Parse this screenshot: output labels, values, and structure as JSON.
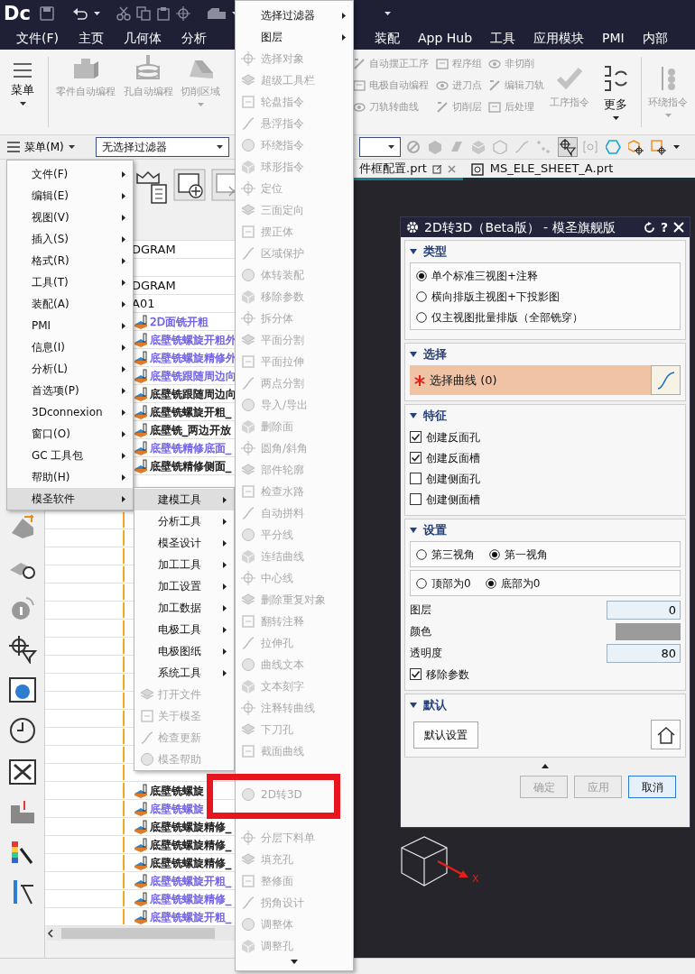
{
  "quick_access": {
    "logo": "Dc"
  },
  "menu_bar": {
    "left": [
      {
        "label": "文件(F)"
      },
      {
        "label": "主页"
      },
      {
        "label": "几何体"
      },
      {
        "label": "分析"
      }
    ],
    "right": [
      {
        "label": "装配"
      },
      {
        "label": "App Hub"
      },
      {
        "label": "工具"
      },
      {
        "label": "应用模块"
      },
      {
        "label": "PMI"
      },
      {
        "label": "内部"
      }
    ]
  },
  "ribbon": {
    "menu_button": "菜单",
    "left_tools": [
      {
        "label": "零件自动编程",
        "enabled": false,
        "dropdown": false
      },
      {
        "label": "孔自动编程",
        "enabled": false,
        "dropdown": false
      },
      {
        "label": "切削区域",
        "enabled": false,
        "dropdown": true
      }
    ],
    "small_tools": [
      [
        {
          "label": "自动摆正工序",
          "enabled": false
        },
        {
          "label": "电极自动编程",
          "enabled": false
        },
        {
          "label": "刀轨转曲线",
          "enabled": false
        }
      ],
      [
        {
          "label": "程序组",
          "enabled": false
        },
        {
          "label": "进刀点",
          "enabled": false
        },
        {
          "label": "切削层",
          "enabled": false
        }
      ],
      [
        {
          "label": "非切削",
          "enabled": false
        },
        {
          "label": "编辑刀轨",
          "enabled": false
        },
        {
          "label": "后处理",
          "enabled": false
        }
      ]
    ],
    "big_tools": [
      {
        "label": "工序指令",
        "enabled": false,
        "dropdown": false
      },
      {
        "label": "更多",
        "enabled": true,
        "dropdown": true
      },
      {
        "label": "环绕指令",
        "enabled": false,
        "dropdown": true
      }
    ]
  },
  "toolbar": {
    "menu_button": "菜单(M)",
    "filter_dropdown": "无选择过滤器"
  },
  "file_tabs": [
    {
      "label": "件框配置.prt",
      "selected": true
    },
    {
      "label": "MS_ELE_SHEET_A.prt",
      "selected": false
    }
  ],
  "navigator": {
    "rows": [
      {
        "kind": "group",
        "label": "DGRAM"
      },
      {
        "kind": "empty"
      },
      {
        "kind": "group",
        "label": "DGRAM"
      },
      {
        "kind": "group",
        "label": "A01"
      },
      {
        "kind": "operation",
        "label": "2D面铣开粗",
        "color": "#6e5ee6"
      },
      {
        "kind": "operation",
        "label": "底壁铣螺旋开粗外",
        "color": "#6e5ee6"
      },
      {
        "kind": "operation",
        "label": "底壁铣螺旋精修外",
        "color": "#6e5ee6"
      },
      {
        "kind": "operation",
        "label": "底壁铣跟随周边向",
        "color": "#6e5ee6"
      },
      {
        "kind": "operation",
        "label": "底壁铣跟随周边向",
        "color": "#111111"
      },
      {
        "kind": "operation",
        "label": "底壁铣螺旋开粗_",
        "color": "#111111"
      },
      {
        "kind": "operation",
        "label": "底壁铣_两边开放",
        "color": "#111111"
      },
      {
        "kind": "operation",
        "label": "底壁铣精修底面_",
        "color": "#6e5ee6"
      },
      {
        "kind": "operation",
        "label": "底壁铣精修侧面_",
        "color": "#111111"
      },
      {
        "kind": "empty"
      },
      {
        "kind": "empty"
      },
      {
        "kind": "empty"
      },
      {
        "kind": "empty"
      },
      {
        "kind": "empty"
      },
      {
        "kind": "empty"
      },
      {
        "kind": "empty"
      },
      {
        "kind": "empty"
      },
      {
        "kind": "empty"
      },
      {
        "kind": "empty"
      },
      {
        "kind": "empty"
      },
      {
        "kind": "empty"
      },
      {
        "kind": "empty"
      },
      {
        "kind": "empty"
      },
      {
        "kind": "empty"
      },
      {
        "kind": "empty"
      },
      {
        "kind": "empty"
      },
      {
        "kind": "operation",
        "label": "底壁铣螺旋",
        "color": "#111111"
      },
      {
        "kind": "operation",
        "label": "底壁铣螺旋",
        "color": "#6e5ee6"
      },
      {
        "kind": "operation",
        "label": "底壁铣螺旋精修_",
        "color": "#111111"
      },
      {
        "kind": "operation",
        "label": "底壁铣螺旋精修_",
        "color": "#111111"
      },
      {
        "kind": "operation",
        "label": "底壁铣螺旋精修_",
        "color": "#111111"
      },
      {
        "kind": "operation",
        "label": "底壁铣螺旋开粗_",
        "color": "#6e5ee6"
      },
      {
        "kind": "operation",
        "label": "底壁铣螺旋精修_",
        "color": "#6e5ee6"
      },
      {
        "kind": "operation",
        "label": "底壁铣螺旋开粗_",
        "color": "#6e5ee6"
      }
    ]
  },
  "main_menu": [
    {
      "label": "文件(F)",
      "selected": false
    },
    {
      "label": "编辑(E)",
      "selected": false
    },
    {
      "label": "视图(V)",
      "selected": false
    },
    {
      "label": "插入(S)",
      "selected": false
    },
    {
      "label": "格式(R)",
      "selected": false
    },
    {
      "label": "工具(T)",
      "selected": false
    },
    {
      "label": "装配(A)",
      "selected": false
    },
    {
      "label": "PMI",
      "selected": false
    },
    {
      "label": "信息(I)",
      "selected": false
    },
    {
      "label": "分析(L)",
      "selected": false
    },
    {
      "label": "首选项(P)",
      "selected": false
    },
    {
      "label": "3Dconnexion",
      "selected": false
    },
    {
      "label": "窗口(O)",
      "selected": false
    },
    {
      "label": "GC 工具包",
      "selected": false
    },
    {
      "label": "帮助(H)",
      "selected": false
    },
    {
      "label": "模圣软件",
      "selected": true
    }
  ],
  "software_menu": [
    {
      "kind": "submenu",
      "label": "建模工具",
      "enabled": true,
      "selected": true
    },
    {
      "kind": "submenu",
      "label": "分析工具",
      "enabled": true,
      "selected": false
    },
    {
      "kind": "submenu",
      "label": "模圣设计",
      "enabled": true,
      "selected": false
    },
    {
      "kind": "submenu",
      "label": "加工工具",
      "enabled": true,
      "selected": false
    },
    {
      "kind": "submenu",
      "label": "加工设置",
      "enabled": true,
      "selected": false
    },
    {
      "kind": "submenu",
      "label": "加工数据",
      "enabled": true,
      "selected": false
    },
    {
      "kind": "submenu",
      "label": "电极工具",
      "enabled": true,
      "selected": false
    },
    {
      "kind": "submenu",
      "label": "电极图纸",
      "enabled": true,
      "selected": false
    },
    {
      "kind": "submenu",
      "label": "系统工具",
      "enabled": true,
      "selected": false
    },
    {
      "kind": "command",
      "label": "打开文件",
      "enabled": false,
      "selected": false
    },
    {
      "kind": "command",
      "label": "关于模圣",
      "enabled": false,
      "selected": false
    },
    {
      "kind": "command",
      "label": "检查更新",
      "enabled": false,
      "selected": false
    },
    {
      "kind": "command",
      "label": "模圣帮助",
      "enabled": false,
      "selected": false
    }
  ],
  "modeling_menu": [
    {
      "kind": "submenu",
      "label": "选择过滤器",
      "enabled": true,
      "highlighted": false
    },
    {
      "kind": "submenu",
      "label": "图层",
      "enabled": true,
      "highlighted": false
    },
    {
      "kind": "command",
      "label": "选择对象",
      "enabled": false,
      "highlighted": false
    },
    {
      "kind": "command",
      "label": "超级工具栏",
      "enabled": false,
      "highlighted": false
    },
    {
      "kind": "command",
      "label": "轮盘指令",
      "enabled": false,
      "highlighted": false
    },
    {
      "kind": "command",
      "label": "悬浮指令",
      "enabled": false,
      "highlighted": false
    },
    {
      "kind": "command",
      "label": "环绕指令",
      "enabled": false,
      "highlighted": false
    },
    {
      "kind": "command",
      "label": "球形指令",
      "enabled": false,
      "highlighted": false
    },
    {
      "kind": "command",
      "label": "定位",
      "enabled": false,
      "highlighted": false
    },
    {
      "kind": "command",
      "label": "三面定向",
      "enabled": false,
      "highlighted": false
    },
    {
      "kind": "command",
      "label": "摆正体",
      "enabled": false,
      "highlighted": false
    },
    {
      "kind": "command",
      "label": "区域保护",
      "enabled": false,
      "highlighted": false
    },
    {
      "kind": "command",
      "label": "体转装配",
      "enabled": false,
      "highlighted": false
    },
    {
      "kind": "command",
      "label": "移除参数",
      "enabled": false,
      "highlighted": false
    },
    {
      "kind": "command",
      "label": "拆分体",
      "enabled": false,
      "highlighted": false
    },
    {
      "kind": "command",
      "label": "平面分割",
      "enabled": false,
      "highlighted": false
    },
    {
      "kind": "command",
      "label": "平面拉伸",
      "enabled": false,
      "highlighted": false
    },
    {
      "kind": "command",
      "label": "两点分割",
      "enabled": false,
      "highlighted": false
    },
    {
      "kind": "command",
      "label": "导入/导出",
      "enabled": false,
      "highlighted": false
    },
    {
      "kind": "command",
      "label": "删除面",
      "enabled": false,
      "highlighted": false
    },
    {
      "kind": "command",
      "label": "圆角/斜角",
      "enabled": false,
      "highlighted": false
    },
    {
      "kind": "command",
      "label": "部件轮廓",
      "enabled": false,
      "highlighted": false
    },
    {
      "kind": "command",
      "label": "检查水路",
      "enabled": false,
      "highlighted": false
    },
    {
      "kind": "command",
      "label": "自动拼料",
      "enabled": false,
      "highlighted": false
    },
    {
      "kind": "command",
      "label": "平分线",
      "enabled": false,
      "highlighted": false
    },
    {
      "kind": "command",
      "label": "连结曲线",
      "enabled": false,
      "highlighted": false
    },
    {
      "kind": "command",
      "label": "中心线",
      "enabled": false,
      "highlighted": false
    },
    {
      "kind": "command",
      "label": "删除重复对象",
      "enabled": false,
      "highlighted": false
    },
    {
      "kind": "command",
      "label": "翻转注释",
      "enabled": false,
      "highlighted": false
    },
    {
      "kind": "command",
      "label": "拉伸孔",
      "enabled": false,
      "highlighted": false
    },
    {
      "kind": "command",
      "label": "曲线文本",
      "enabled": false,
      "highlighted": false
    },
    {
      "kind": "command",
      "label": "文本刻字",
      "enabled": false,
      "highlighted": false
    },
    {
      "kind": "command",
      "label": "注释转曲线",
      "enabled": false,
      "highlighted": false
    },
    {
      "kind": "command",
      "label": "下刀孔",
      "enabled": false,
      "highlighted": false
    },
    {
      "kind": "command",
      "label": "截面曲线",
      "enabled": false,
      "highlighted": false
    },
    {
      "kind": "covered"
    },
    {
      "kind": "command",
      "label": "2D转3D",
      "enabled": false,
      "highlighted": true
    },
    {
      "kind": "covered"
    },
    {
      "kind": "command",
      "label": "分层下料单",
      "enabled": false,
      "highlighted": false
    },
    {
      "kind": "command",
      "label": "填充孔",
      "enabled": false,
      "highlighted": false
    },
    {
      "kind": "command",
      "label": "整修面",
      "enabled": false,
      "highlighted": false
    },
    {
      "kind": "command",
      "label": "拐角设计",
      "enabled": false,
      "highlighted": false
    },
    {
      "kind": "command",
      "label": "调整体",
      "enabled": false,
      "highlighted": false
    },
    {
      "kind": "command",
      "label": "调整孔",
      "enabled": false,
      "highlighted": false
    }
  ],
  "dialog": {
    "title": "2D转3D（Beta版） - 模圣旗舰版",
    "help": "?",
    "sections": [
      {
        "kind": "radios",
        "title": "类型",
        "expanded": true,
        "options": [
          {
            "label": "单个标准三视图+注释",
            "selected": true
          },
          {
            "label": "横向排版主视图+下投影图",
            "selected": false
          },
          {
            "label": "仅主视图批量排版（全部铣穿）",
            "selected": false
          }
        ]
      },
      {
        "kind": "selection",
        "title": "选择",
        "expanded": true,
        "label": "选择曲线 (0)",
        "required": true
      },
      {
        "kind": "checks",
        "title": "特征",
        "expanded": true,
        "options": [
          {
            "label": "创建反面孔",
            "checked": true
          },
          {
            "label": "创建反面槽",
            "checked": true
          },
          {
            "label": "创建侧面孔",
            "checked": false
          },
          {
            "label": "创建侧面槽",
            "checked": false
          }
        ]
      },
      {
        "kind": "settings",
        "title": "设置",
        "expanded": true,
        "radio_rows": [
          [
            {
              "label": "第三视角",
              "selected": false
            },
            {
              "label": "第一视角",
              "selected": true
            }
          ],
          [
            {
              "label": "顶部为0",
              "selected": false
            },
            {
              "label": "底部为0",
              "selected": true
            }
          ]
        ],
        "fields": [
          {
            "kind": "number",
            "label": "图层",
            "value": "0"
          },
          {
            "kind": "color",
            "label": "颜色",
            "color": "#9b9b9b"
          },
          {
            "kind": "number",
            "label": "透明度",
            "value": "80"
          }
        ],
        "checks": [
          {
            "label": "移除参数",
            "checked": true
          }
        ]
      },
      {
        "kind": "defaults",
        "title": "默认",
        "expanded": true,
        "button": "默认设置"
      }
    ],
    "buttons": [
      {
        "label": "确定",
        "enabled": false,
        "default": false
      },
      {
        "label": "应用",
        "enabled": false,
        "default": false
      },
      {
        "label": "取消",
        "enabled": true,
        "default": true
      }
    ]
  },
  "triad_label": "X"
}
